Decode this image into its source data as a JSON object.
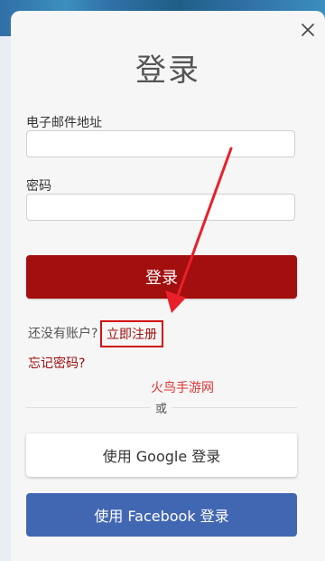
{
  "dialog": {
    "title": "登录",
    "email_label": "电子邮件地址",
    "email_value": "",
    "email_placeholder": "",
    "password_label": "密码",
    "password_value": "",
    "password_placeholder": "",
    "login_button": "登录",
    "no_account_text": "还没有账户?",
    "register_link": "立即注册",
    "forgot_password": "忘记密码?",
    "watermark": "火鸟手游网",
    "or_text": "或",
    "google_button": "使用 Google 登录",
    "facebook_button": "使用 Facebook 登录",
    "close_icon": "close-icon"
  },
  "colors": {
    "primary": "#a30e0e",
    "link": "#9e0b0b",
    "facebook": "#4267b2",
    "annotation": "#e8202a"
  }
}
